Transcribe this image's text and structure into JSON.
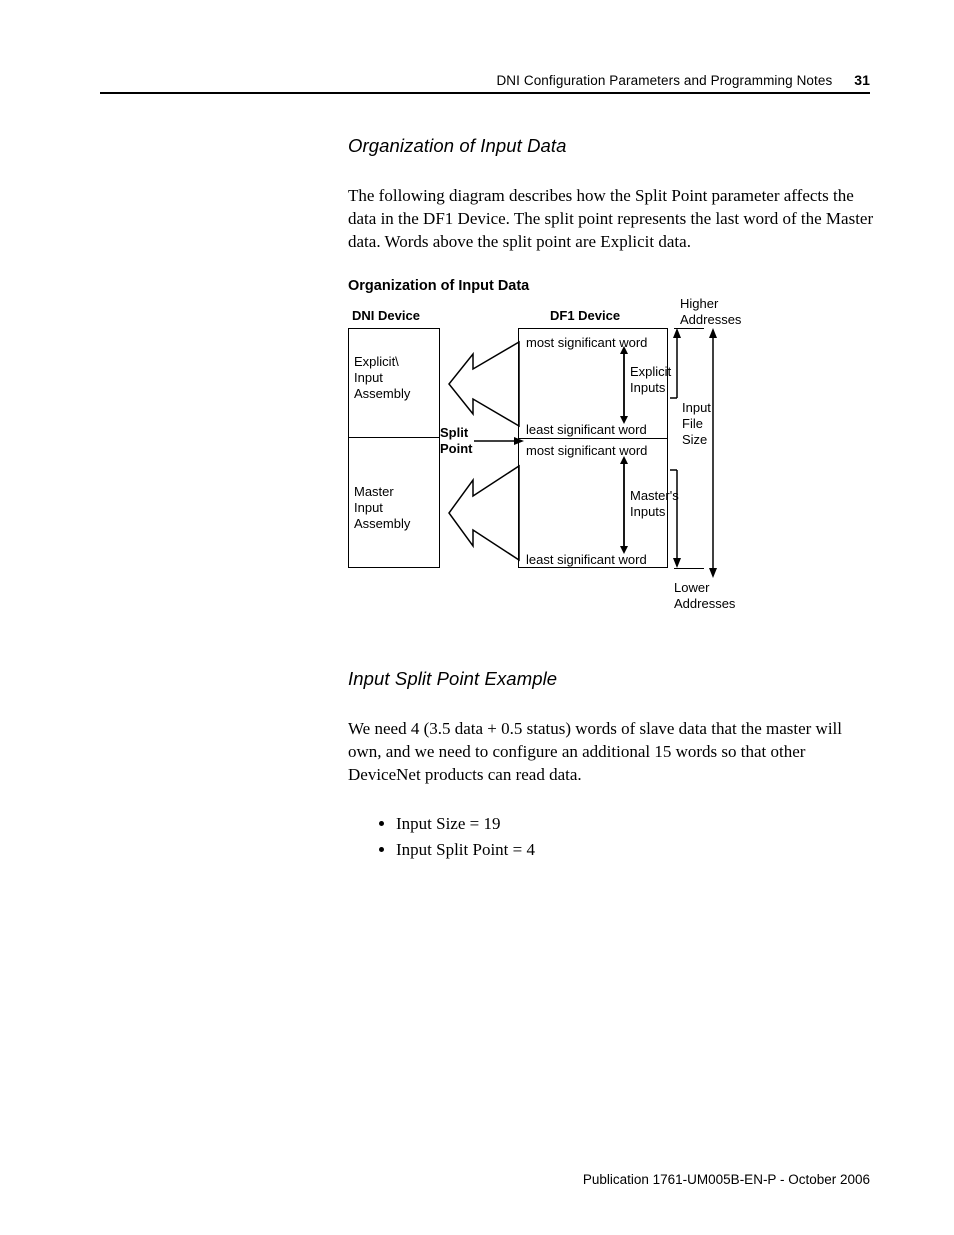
{
  "header": {
    "title": "DNI Configuration Parameters and Programming Notes",
    "page_number": "31"
  },
  "section1": {
    "heading": "Organization of Input Data",
    "paragraph": "The following diagram describes how the Split Point parameter affects the data in the DF1 Device. The split point represents the last word of the Master data. Words above the split point are Explicit data."
  },
  "diagram": {
    "title": "Organization of Input Data",
    "dni_device": "DNI Device",
    "df1_device": "DF1 Device",
    "explicit_assembly": "Explicit\\\nInput\nAssembly",
    "master_assembly": "Master\nInput\nAssembly",
    "split_point": "Split\nPoint",
    "msw": "most significant word",
    "lsw": "least significant word",
    "explicit_inputs": "Explicit\nInputs",
    "masters_inputs": "Master's\nInputs",
    "input_file_size": "Input\nFile\nSize",
    "higher_addresses": "Higher\nAddresses",
    "lower_addresses": "Lower\nAddresses"
  },
  "section2": {
    "heading": "Input Split Point Example",
    "paragraph": "We need 4 (3.5 data + 0.5 status) words of slave data that the master will own, and we need to configure an additional 15 words so that other DeviceNet products can read data.",
    "bullets": [
      "Input Size = 19",
      "Input Split Point = 4"
    ]
  },
  "footer": {
    "text": "Publication 1761-UM005B-EN-P - October 2006"
  }
}
